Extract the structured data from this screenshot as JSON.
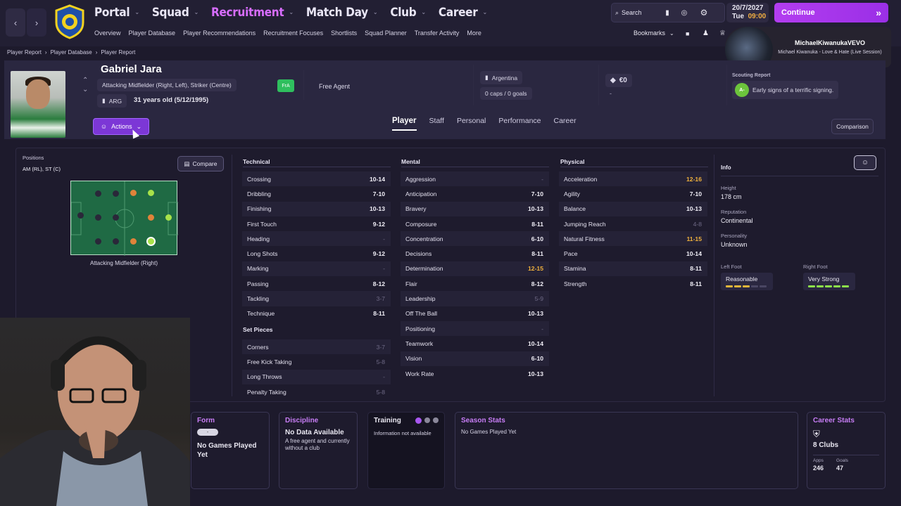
{
  "topbar": {
    "menu": [
      {
        "label": "Portal",
        "active": false
      },
      {
        "label": "Squad",
        "active": false
      },
      {
        "label": "Recruitment",
        "active": true
      },
      {
        "label": "Match Day",
        "active": false
      },
      {
        "label": "Club",
        "active": false
      },
      {
        "label": "Career",
        "active": false
      }
    ],
    "submenu": [
      "Overview",
      "Player Database",
      "Player Recommendations",
      "Recruitment Focuses",
      "Shortlists",
      "Squad Planner",
      "Transfer Activity",
      "More"
    ],
    "search_label": "Search",
    "bookmarks_label": "Bookmarks",
    "date": "20/7/2027",
    "day": "Tue",
    "time": "09:00",
    "continue_label": "Continue",
    "accent": "#b33df0"
  },
  "song": {
    "channel": "MichaelKiwanukaVEVO",
    "title": "Michael Kiwanuka - Love & Hate (Live Session)"
  },
  "breadcrumb": [
    "Player Report",
    "Player Database",
    "Player Report"
  ],
  "player": {
    "name": "Gabriel Jara",
    "positions_text": "Attacking Midfielder (Right, Left), Striker (Centre)",
    "nation_code": "ARG",
    "age_text": "31 years old (5/12/1995)",
    "status_badge": "FrA",
    "contract": "Free Agent",
    "nationality": "Argentina",
    "caps": "0 caps / 0 goals",
    "value": "€0",
    "value_sub": "-",
    "scouting_label": "Scouting Report",
    "scout_grade": "A-",
    "scout_summary": "Early signs of a terrific signing."
  },
  "actions_label": "Actions",
  "tabs": [
    "Player",
    "Staff",
    "Personal",
    "Performance",
    "Career"
  ],
  "comparison_label": "Comparison",
  "positions": {
    "label": "Positions",
    "value": "AM (RL), ST (C)",
    "compare_label": "Compare",
    "selected_role": "Attacking Midfielder (Right)"
  },
  "technical": {
    "title": "Technical",
    "rows": [
      {
        "name": "Crossing",
        "value": "10-14",
        "style": ""
      },
      {
        "name": "Dribbling",
        "value": "7-10",
        "style": ""
      },
      {
        "name": "Finishing",
        "value": "10-13",
        "style": ""
      },
      {
        "name": "First Touch",
        "value": "9-12",
        "style": ""
      },
      {
        "name": "Heading",
        "value": "-",
        "style": "dash"
      },
      {
        "name": "Long Shots",
        "value": "9-12",
        "style": ""
      },
      {
        "name": "Marking",
        "value": "-",
        "style": "dash"
      },
      {
        "name": "Passing",
        "value": "8-12",
        "style": ""
      },
      {
        "name": "Tackling",
        "value": "3-7",
        "style": "dim"
      },
      {
        "name": "Technique",
        "value": "8-11",
        "style": ""
      }
    ]
  },
  "set_pieces": {
    "title": "Set Pieces",
    "rows": [
      {
        "name": "Corners",
        "value": "3-7",
        "style": "dim"
      },
      {
        "name": "Free Kick Taking",
        "value": "5-8",
        "style": "dim"
      },
      {
        "name": "Long Throws",
        "value": "-",
        "style": "dash"
      },
      {
        "name": "Penalty Taking",
        "value": "5-8",
        "style": "dim"
      }
    ]
  },
  "mental": {
    "title": "Mental",
    "rows": [
      {
        "name": "Aggression",
        "value": "-",
        "style": "dash"
      },
      {
        "name": "Anticipation",
        "value": "7-10",
        "style": ""
      },
      {
        "name": "Bravery",
        "value": "10-13",
        "style": ""
      },
      {
        "name": "Composure",
        "value": "8-11",
        "style": ""
      },
      {
        "name": "Concentration",
        "value": "6-10",
        "style": ""
      },
      {
        "name": "Decisions",
        "value": "8-11",
        "style": ""
      },
      {
        "name": "Determination",
        "value": "12-15",
        "style": "hi"
      },
      {
        "name": "Flair",
        "value": "8-12",
        "style": ""
      },
      {
        "name": "Leadership",
        "value": "5-9",
        "style": "dim"
      },
      {
        "name": "Off The Ball",
        "value": "10-13",
        "style": ""
      },
      {
        "name": "Positioning",
        "value": "-",
        "style": "dash"
      },
      {
        "name": "Teamwork",
        "value": "10-14",
        "style": ""
      },
      {
        "name": "Vision",
        "value": "6-10",
        "style": ""
      },
      {
        "name": "Work Rate",
        "value": "10-13",
        "style": ""
      }
    ]
  },
  "physical": {
    "title": "Physical",
    "rows": [
      {
        "name": "Acceleration",
        "value": "12-16",
        "style": "hi"
      },
      {
        "name": "Agility",
        "value": "7-10",
        "style": ""
      },
      {
        "name": "Balance",
        "value": "10-13",
        "style": ""
      },
      {
        "name": "Jumping Reach",
        "value": "4-8",
        "style": "dim"
      },
      {
        "name": "Natural Fitness",
        "value": "11-15",
        "style": "hi"
      },
      {
        "name": "Pace",
        "value": "10-14",
        "style": ""
      },
      {
        "name": "Stamina",
        "value": "8-11",
        "style": ""
      },
      {
        "name": "Strength",
        "value": "8-11",
        "style": ""
      }
    ]
  },
  "info": {
    "title": "Info",
    "height_label": "Height",
    "height": "178 cm",
    "reputation_label": "Reputation",
    "reputation": "Continental",
    "personality_label": "Personality",
    "personality": "Unknown",
    "left_foot_label": "Left Foot",
    "left_foot": "Reasonable",
    "right_foot_label": "Right Foot",
    "right_foot": "Very Strong",
    "left_foot_level": 0.6,
    "right_foot_level": 1.0
  },
  "cards": {
    "form_title": "Form",
    "form_badge": "-",
    "form_text": "No Games Played Yet",
    "discipline_title": "Discipline",
    "discipline_head": "No Data Available",
    "discipline_text": "A free agent and currently without a club",
    "training_title": "Training",
    "training_text": "Information not available",
    "season_title": "Season Stats",
    "season_text": "No Games Played Yet",
    "career_title": "Career Stats",
    "career_clubs": "8 Clubs",
    "apps_label": "Apps",
    "apps": "246",
    "goals_label": "Goals",
    "goals": "47"
  },
  "colors": {
    "accent": "#c77df5",
    "highlight": "#f0b13c",
    "good": "#8ce04a",
    "orange": "#e0833a"
  }
}
